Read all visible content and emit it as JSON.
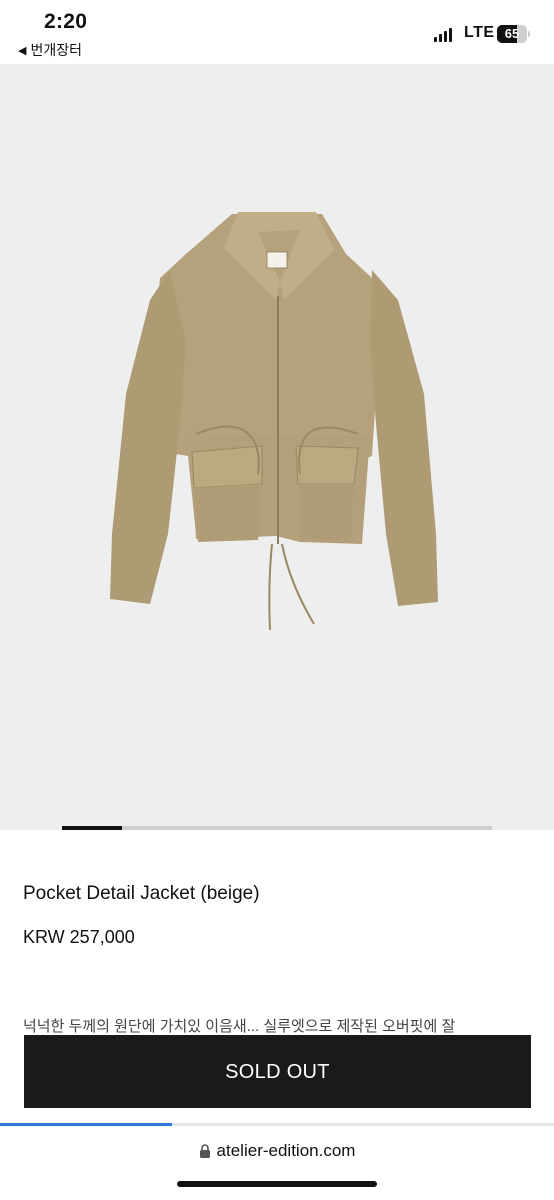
{
  "status_bar": {
    "time": "2:20",
    "back_app": "번개장터",
    "network": "LTE",
    "battery": "65",
    "battery_level": 0.65
  },
  "hero": {
    "image_description_icon": "jacket-product-image",
    "carousel_position": 0.14
  },
  "product": {
    "name": "Pocket Detail Jacket (beige)",
    "price": "KRW 257,000",
    "description_partial": "넉넉한 두께의 원단에 가치있 이음새... 실루엣으로 제작된 오버핏에 잘"
  },
  "cta": {
    "label": "SOLD OUT"
  },
  "browser": {
    "url": "atelier-edition.com",
    "load_progress": 0.31
  },
  "colors": {
    "accent": "#2f7ad9",
    "button_bg": "#1a1a1a",
    "jacket": "#b3a07a"
  }
}
